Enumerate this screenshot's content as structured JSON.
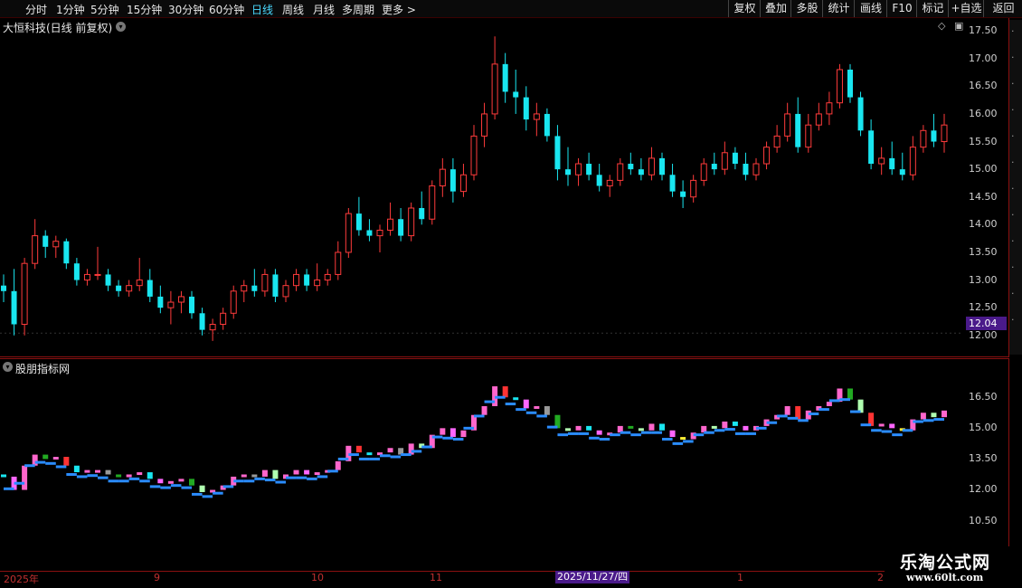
{
  "toolbar": {
    "periods": [
      "分时",
      "1分钟",
      "5分钟",
      "15分钟",
      "30分钟",
      "60分钟",
      "日线",
      "周线",
      "月线",
      "多周期",
      "更多 >"
    ],
    "active_period": "日线",
    "actions": [
      "复权",
      "叠加",
      "多股",
      "统计",
      "画线",
      "F10",
      "标记",
      "+自选",
      "返回"
    ]
  },
  "main_panel": {
    "title": "大恒科技(日线 前复权)",
    "y_ticks": [
      "17.50",
      "17.00",
      "16.50",
      "16.00",
      "15.50",
      "15.00",
      "14.50",
      "14.00",
      "13.50",
      "13.00",
      "12.50",
      "12.00"
    ],
    "current_price": "12.04"
  },
  "indicator_panel": {
    "title": "股朋指标网",
    "y_ticks": [
      "16.50",
      "15.00",
      "13.50",
      "12.00",
      "10.50"
    ]
  },
  "x_axis": {
    "labels": [
      "2025年",
      "9",
      "10",
      "11",
      "1",
      "2"
    ],
    "cursor_date": "2025/11/27/四"
  },
  "watermark": {
    "name": "乐淘公式网",
    "url": "www.60lt.com"
  },
  "colors": {
    "up": "#ff3b3b",
    "down": "#19e6f0",
    "border": "#8a1010",
    "active": "#4ad9ff",
    "price_tag": "#4a1a8a"
  },
  "chart_data": {
    "type": "candlestick",
    "title": "大恒科技(日线 前复权)",
    "ylim": [
      11.8,
      17.6
    ],
    "x_labels": [
      "2025年",
      "9",
      "10",
      "11",
      "1",
      "2"
    ],
    "series": [
      {
        "values": [
          [
            12.9,
            13.1,
            12.6,
            12.8
          ],
          [
            12.8,
            13.2,
            12.0,
            12.2
          ],
          [
            12.2,
            13.4,
            12.0,
            13.3
          ],
          [
            13.3,
            14.1,
            13.2,
            13.8
          ],
          [
            13.8,
            13.9,
            13.4,
            13.6
          ],
          [
            13.6,
            13.8,
            13.4,
            13.7
          ],
          [
            13.7,
            13.75,
            13.2,
            13.3
          ],
          [
            13.3,
            13.4,
            12.9,
            13.0
          ],
          [
            13.0,
            13.2,
            12.9,
            13.1
          ],
          [
            13.1,
            13.6,
            13.0,
            13.1
          ],
          [
            13.1,
            13.2,
            12.8,
            12.9
          ],
          [
            12.9,
            13.0,
            12.7,
            12.8
          ],
          [
            12.8,
            13.0,
            12.7,
            12.9
          ],
          [
            12.9,
            13.4,
            12.8,
            13.0
          ],
          [
            13.0,
            13.2,
            12.6,
            12.7
          ],
          [
            12.7,
            12.9,
            12.4,
            12.5
          ],
          [
            12.5,
            12.8,
            12.2,
            12.6
          ],
          [
            12.6,
            12.8,
            12.4,
            12.7
          ],
          [
            12.7,
            12.8,
            12.3,
            12.4
          ],
          [
            12.4,
            12.5,
            12.0,
            12.1
          ],
          [
            12.1,
            12.3,
            11.9,
            12.2
          ],
          [
            12.2,
            12.5,
            12.1,
            12.4
          ],
          [
            12.4,
            12.9,
            12.3,
            12.8
          ],
          [
            12.8,
            13.0,
            12.6,
            12.9
          ],
          [
            12.9,
            13.2,
            12.7,
            12.8
          ],
          [
            12.8,
            13.2,
            12.7,
            13.1
          ],
          [
            13.1,
            13.2,
            12.6,
            12.7
          ],
          [
            12.7,
            13.0,
            12.6,
            12.9
          ],
          [
            12.9,
            13.2,
            12.8,
            13.1
          ],
          [
            13.1,
            13.2,
            12.8,
            12.9
          ],
          [
            12.9,
            13.3,
            12.8,
            13.0
          ],
          [
            13.0,
            13.2,
            12.9,
            13.1
          ],
          [
            13.1,
            13.7,
            13.0,
            13.5
          ],
          [
            13.5,
            14.3,
            13.4,
            14.2
          ],
          [
            14.2,
            14.5,
            13.8,
            13.9
          ],
          [
            13.9,
            14.1,
            13.7,
            13.8
          ],
          [
            13.8,
            14.0,
            13.5,
            13.9
          ],
          [
            13.9,
            14.4,
            13.8,
            14.1
          ],
          [
            14.1,
            14.3,
            13.7,
            13.8
          ],
          [
            13.8,
            14.4,
            13.7,
            14.3
          ],
          [
            14.3,
            14.6,
            14.0,
            14.1
          ],
          [
            14.1,
            14.8,
            14.0,
            14.7
          ],
          [
            14.7,
            15.2,
            14.5,
            15.0
          ],
          [
            15.0,
            15.2,
            14.4,
            14.6
          ],
          [
            14.6,
            15.1,
            14.5,
            14.9
          ],
          [
            14.9,
            15.8,
            14.8,
            15.6
          ],
          [
            15.6,
            16.2,
            15.4,
            16.0
          ],
          [
            16.0,
            17.4,
            15.9,
            16.9
          ],
          [
            16.9,
            17.1,
            16.2,
            16.4
          ],
          [
            16.4,
            16.8,
            16.0,
            16.3
          ],
          [
            16.3,
            16.5,
            15.7,
            15.9
          ],
          [
            15.9,
            16.2,
            15.6,
            16.0
          ],
          [
            16.0,
            16.1,
            15.5,
            15.6
          ],
          [
            15.6,
            15.8,
            14.8,
            15.0
          ],
          [
            15.0,
            15.4,
            14.7,
            14.9
          ],
          [
            14.9,
            15.2,
            14.7,
            15.1
          ],
          [
            15.1,
            15.3,
            14.8,
            14.9
          ],
          [
            14.9,
            15.1,
            14.6,
            14.7
          ],
          [
            14.7,
            14.9,
            14.5,
            14.8
          ],
          [
            14.8,
            15.2,
            14.7,
            15.1
          ],
          [
            15.1,
            15.3,
            14.9,
            15.0
          ],
          [
            15.0,
            15.2,
            14.8,
            14.9
          ],
          [
            14.9,
            15.4,
            14.8,
            15.2
          ],
          [
            15.2,
            15.3,
            14.8,
            14.9
          ],
          [
            14.9,
            15.1,
            14.5,
            14.6
          ],
          [
            14.6,
            14.8,
            14.3,
            14.5
          ],
          [
            14.5,
            14.9,
            14.4,
            14.8
          ],
          [
            14.8,
            15.2,
            14.7,
            15.1
          ],
          [
            15.1,
            15.3,
            14.9,
            15.0
          ],
          [
            15.0,
            15.5,
            14.9,
            15.3
          ],
          [
            15.3,
            15.4,
            15.0,
            15.1
          ],
          [
            15.1,
            15.3,
            14.8,
            14.9
          ],
          [
            14.9,
            15.2,
            14.8,
            15.1
          ],
          [
            15.1,
            15.5,
            15.0,
            15.4
          ],
          [
            15.4,
            15.8,
            15.3,
            15.6
          ],
          [
            15.6,
            16.2,
            15.5,
            16.0
          ],
          [
            16.0,
            16.3,
            15.3,
            15.4
          ],
          [
            15.4,
            16.0,
            15.3,
            15.8
          ],
          [
            15.8,
            16.2,
            15.7,
            16.0
          ],
          [
            16.0,
            16.4,
            15.8,
            16.2
          ],
          [
            16.2,
            16.9,
            16.1,
            16.8
          ],
          [
            16.8,
            16.9,
            16.2,
            16.3
          ],
          [
            16.3,
            16.4,
            15.6,
            15.7
          ],
          [
            15.7,
            15.9,
            15.0,
            15.1
          ],
          [
            15.1,
            15.4,
            14.9,
            15.2
          ],
          [
            15.2,
            15.5,
            14.9,
            15.0
          ],
          [
            15.0,
            15.3,
            14.8,
            14.9
          ],
          [
            14.9,
            15.6,
            14.8,
            15.4
          ],
          [
            15.4,
            15.8,
            15.3,
            15.7
          ],
          [
            15.7,
            16.0,
            15.4,
            15.5
          ],
          [
            15.5,
            16.0,
            15.3,
            15.8
          ]
        ]
      }
    ]
  }
}
